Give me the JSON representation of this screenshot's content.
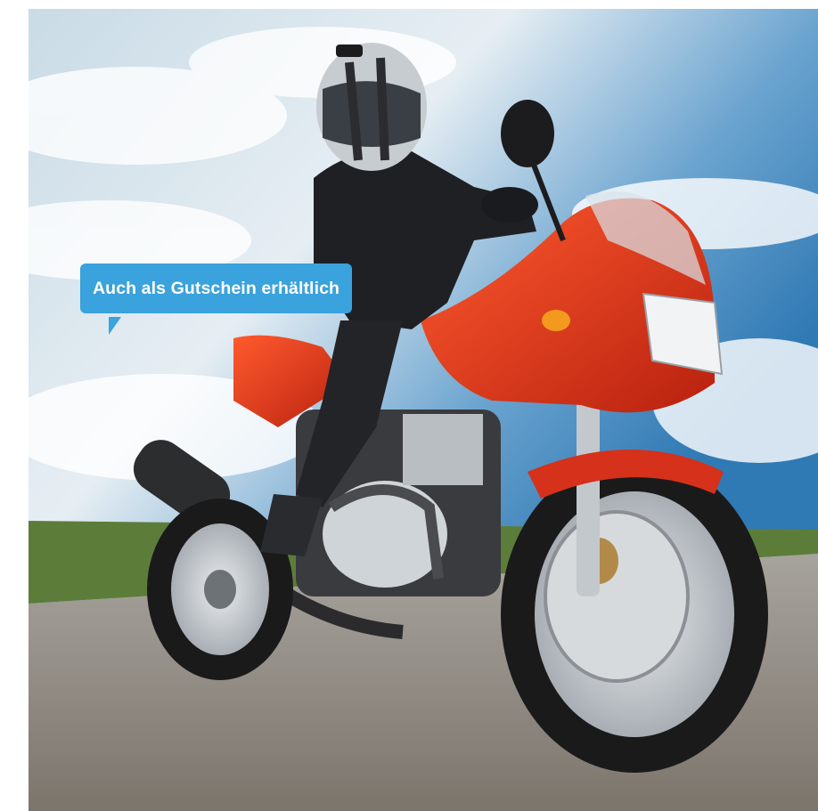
{
  "image": {
    "subject": "motorcycle-rider-photo",
    "colors": {
      "sky_top": "#4f8fc2",
      "sky_light": "#dbe7ef",
      "grass": "#5c7d3a",
      "road": "#8f8a83",
      "bike_red": "#e0301a",
      "rider_black": "#1e2024",
      "chrome": "#c9cfd4",
      "tire": "#1a1a1b"
    }
  },
  "badge": {
    "label": "Auch als Gutschein erhältlich",
    "background": "#3aa2dc",
    "text_color": "#ffffff"
  }
}
